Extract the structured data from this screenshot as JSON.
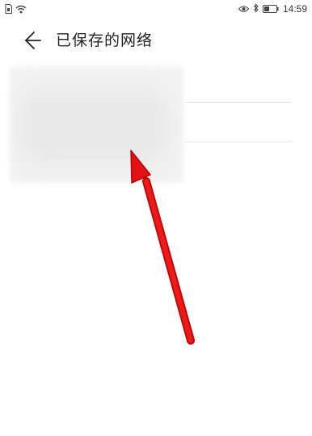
{
  "status_bar": {
    "time": "14:59",
    "left_icons": [
      "sim-card-icon",
      "wifi-icon"
    ],
    "right_icons": [
      "eye-icon",
      "bluetooth-icon",
      "battery-icon"
    ]
  },
  "header": {
    "title": "已保存的网络",
    "back_icon": "back-arrow-icon"
  },
  "saved_networks": [
    {
      "ssid": ""
    },
    {
      "ssid": ""
    }
  ],
  "annotation": {
    "type": "red-arrow",
    "color": "#e01010"
  }
}
